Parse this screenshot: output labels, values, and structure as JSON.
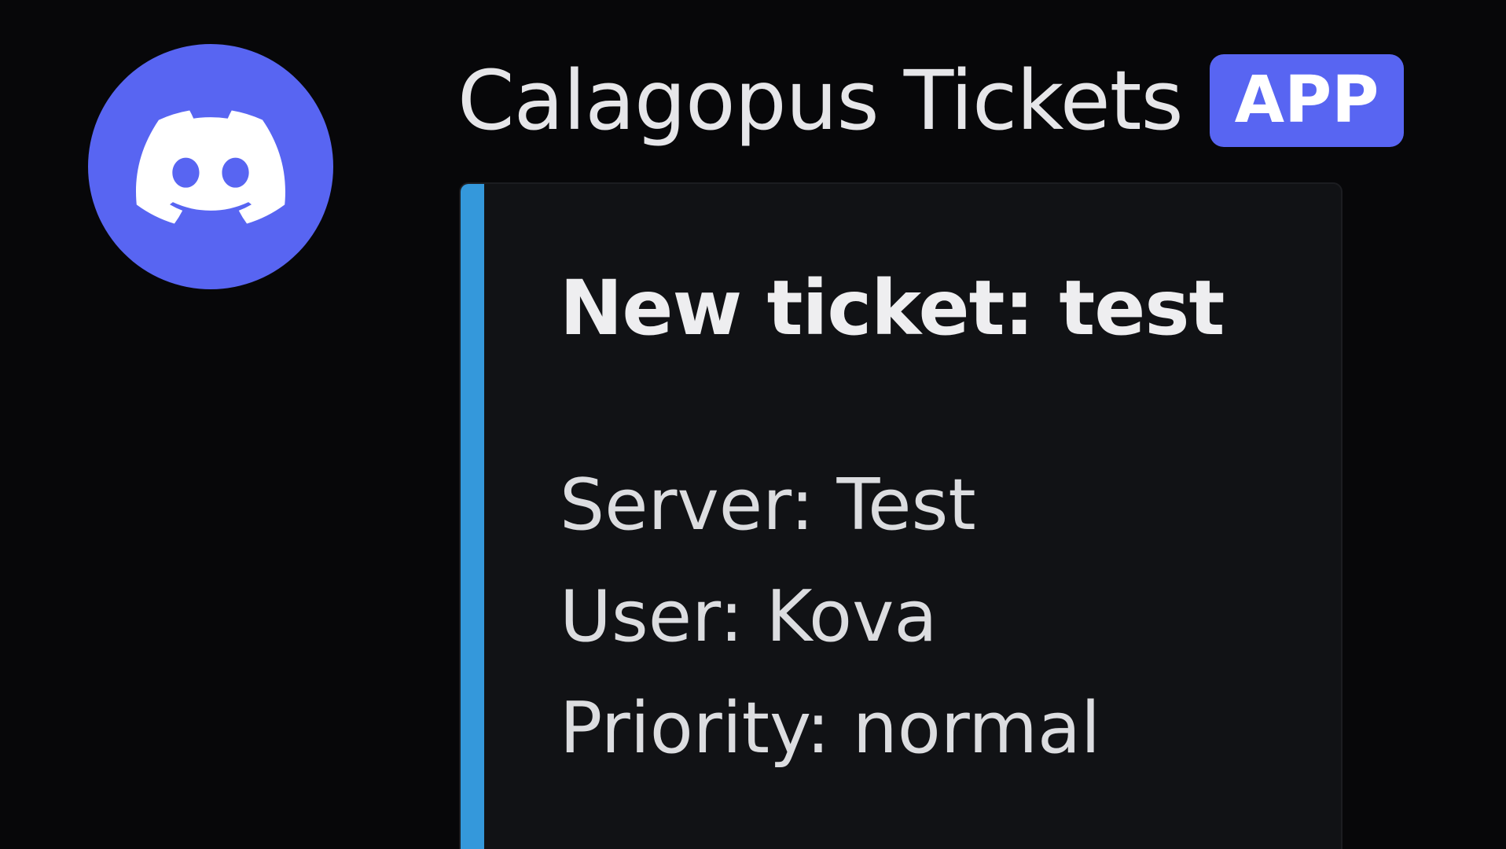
{
  "message": {
    "author": {
      "name": "Calagopus Tickets",
      "badge": "APP",
      "avatar_icon": "discord-logo-icon",
      "avatar_color": "#5865F2"
    },
    "embed": {
      "accent_color": "#3498DB",
      "title": "New ticket: test",
      "lines": [
        "Server: Test",
        "User: Kova",
        "Priority: normal"
      ]
    }
  }
}
